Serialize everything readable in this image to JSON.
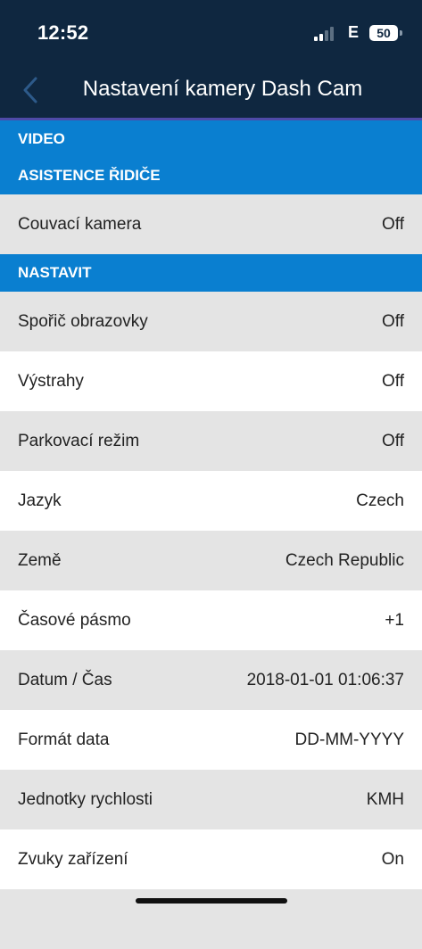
{
  "status": {
    "time": "12:52",
    "network": "E",
    "battery": "50"
  },
  "nav": {
    "title": "Nastavení kamery Dash Cam"
  },
  "sections": {
    "video": "VIDEO",
    "driver_assist": "ASISTENCE ŘIDIČE",
    "setup": "NASTAVIT"
  },
  "driver_assist_rows": [
    {
      "label": "Couvací kamera",
      "value": "Off"
    }
  ],
  "setup_rows": [
    {
      "label": "Spořič obrazovky",
      "value": "Off"
    },
    {
      "label": "Výstrahy",
      "value": "Off"
    },
    {
      "label": "Parkovací režim",
      "value": "Off"
    },
    {
      "label": "Jazyk",
      "value": "Czech"
    },
    {
      "label": "Země",
      "value": "Czech Republic"
    },
    {
      "label": "Časové pásmo",
      "value": "+1"
    },
    {
      "label": "Datum / Čas",
      "value": "2018-01-01 01:06:37"
    },
    {
      "label": "Formát data",
      "value": "DD-MM-YYYY"
    },
    {
      "label": "Jednotky rychlosti",
      "value": "KMH"
    },
    {
      "label": "Zvuky zařízení",
      "value": "On"
    }
  ]
}
